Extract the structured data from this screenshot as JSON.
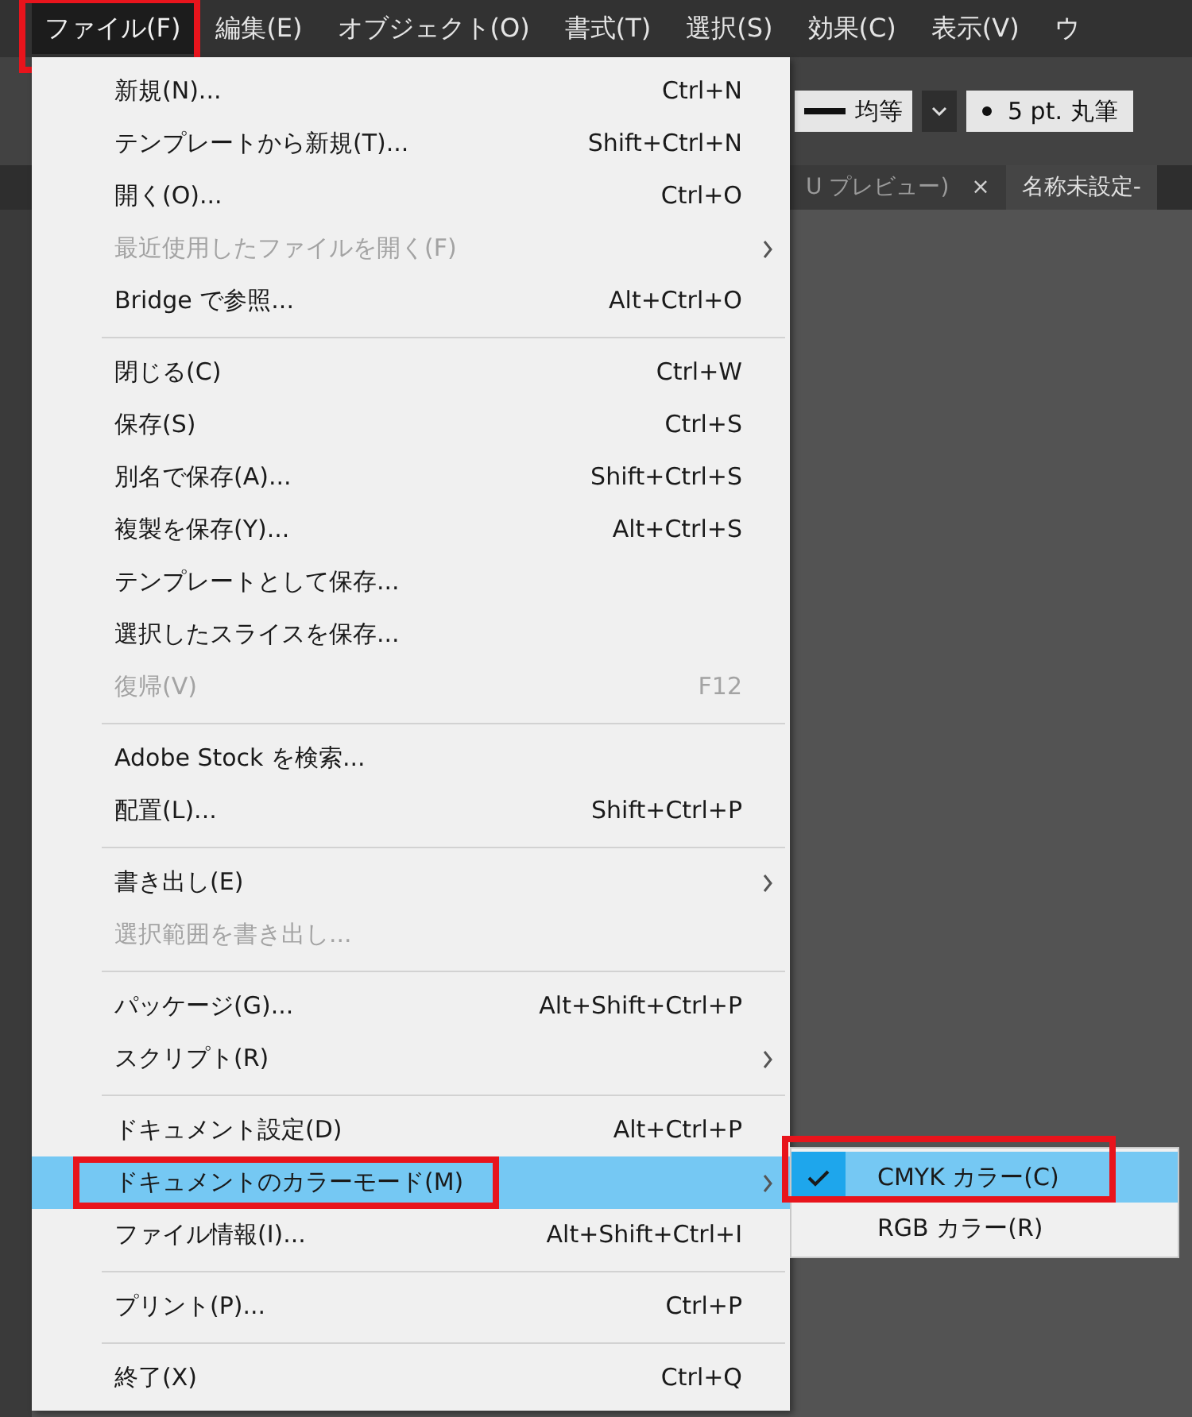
{
  "menubar": {
    "items": [
      {
        "label": "ファイル(F)",
        "selected": true,
        "annotated": true
      },
      {
        "label": "編集(E)",
        "selected": false,
        "annotated": false
      },
      {
        "label": "オブジェクト(O)",
        "selected": false,
        "annotated": false
      },
      {
        "label": "書式(T)",
        "selected": false,
        "annotated": false
      },
      {
        "label": "選択(S)",
        "selected": false,
        "annotated": false
      },
      {
        "label": "効果(C)",
        "selected": false,
        "annotated": false
      },
      {
        "label": "表示(V)",
        "selected": false,
        "annotated": false
      },
      {
        "label": "ウ",
        "selected": false,
        "annotated": false
      }
    ]
  },
  "control_bar": {
    "stroke_profile": "均等",
    "brush": "5 pt. 丸筆"
  },
  "tabs": [
    {
      "label": "U プレビュー)",
      "close": "×"
    },
    {
      "label": "名称未設定-"
    }
  ],
  "menu": {
    "items": [
      {
        "kind": "item",
        "label": "新規(N)...",
        "shortcut": "Ctrl+N",
        "disabled": false,
        "submenu": false,
        "highlighted": false,
        "annotated": false
      },
      {
        "kind": "item",
        "label": "テンプレートから新規(T)...",
        "shortcut": "Shift+Ctrl+N",
        "disabled": false,
        "submenu": false,
        "highlighted": false,
        "annotated": false
      },
      {
        "kind": "item",
        "label": "開く(O)...",
        "shortcut": "Ctrl+O",
        "disabled": false,
        "submenu": false,
        "highlighted": false,
        "annotated": false
      },
      {
        "kind": "item",
        "label": "最近使用したファイルを開く(F)",
        "disabled": true,
        "submenu": true,
        "highlighted": false,
        "annotated": false
      },
      {
        "kind": "item",
        "label": "Bridge で参照...",
        "shortcut": "Alt+Ctrl+O",
        "disabled": false,
        "submenu": false,
        "highlighted": false,
        "annotated": false
      },
      {
        "kind": "separator"
      },
      {
        "kind": "item",
        "label": "閉じる(C)",
        "shortcut": "Ctrl+W",
        "disabled": false,
        "submenu": false,
        "highlighted": false,
        "annotated": false
      },
      {
        "kind": "item",
        "label": "保存(S)",
        "shortcut": "Ctrl+S",
        "disabled": false,
        "submenu": false,
        "highlighted": false,
        "annotated": false
      },
      {
        "kind": "item",
        "label": "別名で保存(A)...",
        "shortcut": "Shift+Ctrl+S",
        "disabled": false,
        "submenu": false,
        "highlighted": false,
        "annotated": false
      },
      {
        "kind": "item",
        "label": "複製を保存(Y)...",
        "shortcut": "Alt+Ctrl+S",
        "disabled": false,
        "submenu": false,
        "highlighted": false,
        "annotated": false
      },
      {
        "kind": "item",
        "label": "テンプレートとして保存...",
        "disabled": false,
        "submenu": false,
        "highlighted": false,
        "annotated": false
      },
      {
        "kind": "item",
        "label": "選択したスライスを保存...",
        "disabled": false,
        "submenu": false,
        "highlighted": false,
        "annotated": false
      },
      {
        "kind": "item",
        "label": "復帰(V)",
        "shortcut": "F12",
        "disabled": true,
        "submenu": false,
        "highlighted": false,
        "annotated": false
      },
      {
        "kind": "separator"
      },
      {
        "kind": "item",
        "label": "Adobe Stock を検索...",
        "disabled": false,
        "submenu": false,
        "highlighted": false,
        "annotated": false
      },
      {
        "kind": "item",
        "label": "配置(L)...",
        "shortcut": "Shift+Ctrl+P",
        "disabled": false,
        "submenu": false,
        "highlighted": false,
        "annotated": false
      },
      {
        "kind": "separator"
      },
      {
        "kind": "item",
        "label": "書き出し(E)",
        "disabled": false,
        "submenu": true,
        "highlighted": false,
        "annotated": false
      },
      {
        "kind": "item",
        "label": "選択範囲を書き出し...",
        "disabled": true,
        "submenu": false,
        "highlighted": false,
        "annotated": false
      },
      {
        "kind": "separator"
      },
      {
        "kind": "item",
        "label": "パッケージ(G)...",
        "shortcut": "Alt+Shift+Ctrl+P",
        "disabled": false,
        "submenu": false,
        "highlighted": false,
        "annotated": false
      },
      {
        "kind": "item",
        "label": "スクリプト(R)",
        "disabled": false,
        "submenu": true,
        "highlighted": false,
        "annotated": false
      },
      {
        "kind": "separator"
      },
      {
        "kind": "item",
        "label": "ドキュメント設定(D)",
        "shortcut": "Alt+Ctrl+P",
        "disabled": false,
        "submenu": false,
        "highlighted": false,
        "annotated": false
      },
      {
        "kind": "item",
        "label": "ドキュメントのカラーモード(M)",
        "disabled": false,
        "submenu": true,
        "highlighted": true,
        "annotated": true
      },
      {
        "kind": "item",
        "label": "ファイル情報(I)...",
        "shortcut": "Alt+Shift+Ctrl+I",
        "disabled": false,
        "submenu": false,
        "highlighted": false,
        "annotated": false
      },
      {
        "kind": "separator"
      },
      {
        "kind": "item",
        "label": "プリント(P)...",
        "shortcut": "Ctrl+P",
        "disabled": false,
        "submenu": false,
        "highlighted": false,
        "annotated": false
      },
      {
        "kind": "separator"
      },
      {
        "kind": "item",
        "label": "終了(X)",
        "shortcut": "Ctrl+Q",
        "disabled": false,
        "submenu": false,
        "highlighted": false,
        "annotated": false
      }
    ]
  },
  "submenu": {
    "items": [
      {
        "label": "CMYK カラー(C)",
        "checked": true,
        "highlighted": true,
        "annotated": true
      },
      {
        "label": "RGB カラー(R)",
        "checked": false,
        "highlighted": false,
        "annotated": false
      }
    ]
  }
}
